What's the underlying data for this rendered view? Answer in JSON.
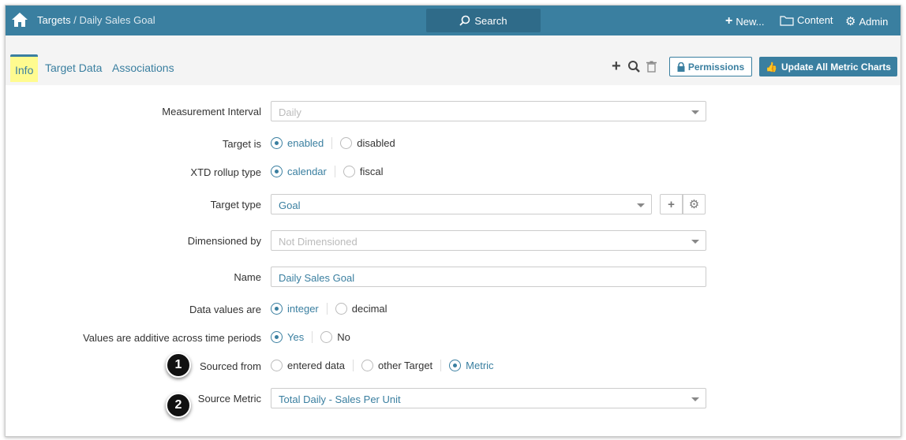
{
  "header": {
    "crumb_parent": "Targets",
    "crumb_sep": " / ",
    "crumb_current": "Daily Sales Goal",
    "search": "Search",
    "new": "New...",
    "content": "Content",
    "admin": "Admin"
  },
  "tabs": [
    "Info",
    "Target Data",
    "Associations"
  ],
  "toolbar": {
    "permissions": "Permissions",
    "update": "Update All Metric Charts"
  },
  "form": {
    "measurement_interval": {
      "label": "Measurement Interval",
      "value": "Daily"
    },
    "target_is": {
      "label": "Target is",
      "options": [
        "enabled",
        "disabled"
      ]
    },
    "xtd": {
      "label": "XTD rollup type",
      "options": [
        "calendar",
        "fiscal"
      ]
    },
    "target_type": {
      "label": "Target type",
      "value": "Goal"
    },
    "dimensioned_by": {
      "label": "Dimensioned by",
      "value": "Not Dimensioned"
    },
    "name": {
      "label": "Name",
      "value": "Daily Sales Goal"
    },
    "data_values": {
      "label": "Data values are",
      "options": [
        "integer",
        "decimal"
      ]
    },
    "additive": {
      "label": "Values are additive across time periods",
      "options": [
        "Yes",
        "No"
      ]
    },
    "sourced_from": {
      "label": "Sourced from",
      "options": [
        "entered data",
        "other Target",
        "Metric"
      ]
    },
    "source_metric": {
      "label": "Source Metric",
      "value": "Total Daily - Sales Per Unit"
    }
  },
  "callouts": [
    "1",
    "2"
  ]
}
